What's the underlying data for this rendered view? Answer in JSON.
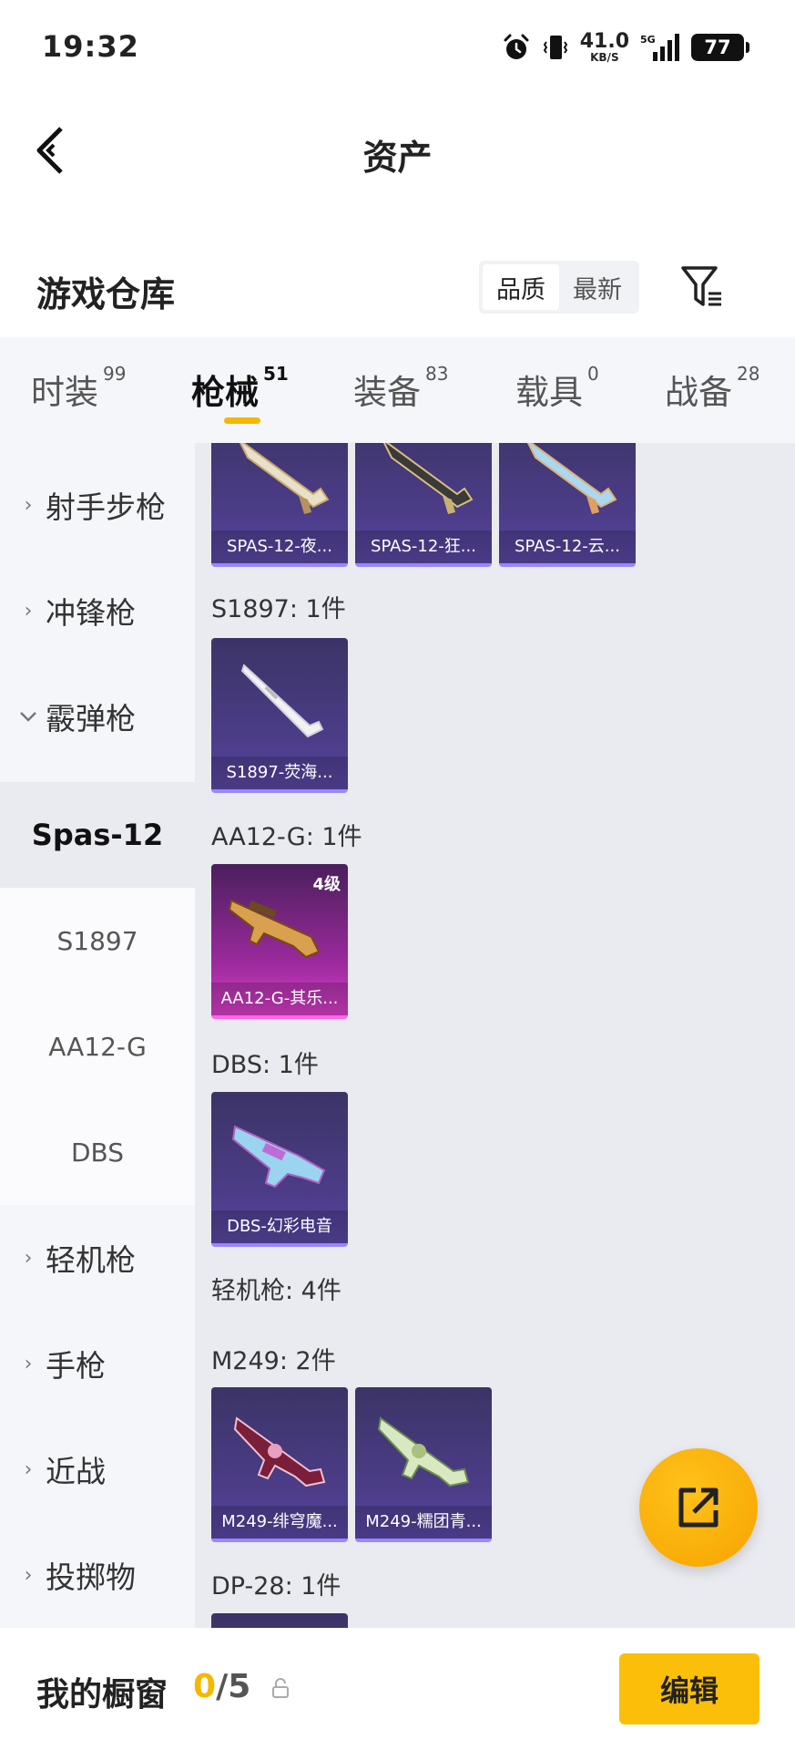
{
  "status": {
    "time": "19:32",
    "net_speed": "41.0",
    "net_unit": "KB/S",
    "network": "5G",
    "battery": "77"
  },
  "header": {
    "title": "资产"
  },
  "section": {
    "title": "游戏仓库",
    "sort_options": [
      "品质",
      "最新"
    ],
    "sort_selected": "品质"
  },
  "tabs": [
    {
      "label": "时装",
      "count": "99"
    },
    {
      "label": "枪械",
      "count": "51"
    },
    {
      "label": "装备",
      "count": "83"
    },
    {
      "label": "载具",
      "count": "0"
    },
    {
      "label": "战备",
      "count": "28"
    }
  ],
  "sidebar": {
    "items": [
      {
        "label": "射手步枪"
      },
      {
        "label": "冲锋枪"
      },
      {
        "label": "霰弹枪"
      }
    ],
    "subitems": [
      {
        "label": "Spas-12"
      },
      {
        "label": "S1897"
      },
      {
        "label": "AA12-G"
      },
      {
        "label": "DBS"
      }
    ],
    "items_after": [
      {
        "label": "轻机枪"
      },
      {
        "label": "手枪"
      },
      {
        "label": "近战"
      },
      {
        "label": "投掷物"
      }
    ]
  },
  "content": {
    "spas_cards": [
      "SPAS-12-夜...",
      "SPAS-12-狂...",
      "SPAS-12-云..."
    ],
    "s1897_label": "S1897: 1件",
    "s1897_cards": [
      "S1897-荧海..."
    ],
    "aa12_label": "AA12-G: 1件",
    "aa12_cards": [
      {
        "name": "AA12-G-其乐...",
        "level": "4级"
      }
    ],
    "dbs_label": "DBS: 1件",
    "dbs_cards": [
      "DBS-幻彩电音"
    ],
    "lmg_label": "轻机枪: 4件",
    "m249_label": "M249: 2件",
    "m249_cards": [
      "M249-绯穹魔...",
      "M249-糯团青..."
    ],
    "dp28_label": "DP-28: 1件"
  },
  "bottom": {
    "window_label": "我的橱窗",
    "window_current": "0",
    "window_total": "/5",
    "edit_label": "编辑"
  },
  "colors": {
    "accent": "#f5b800",
    "epic_card": "#4d3d8a",
    "legendary_card": "#d83fc8"
  }
}
